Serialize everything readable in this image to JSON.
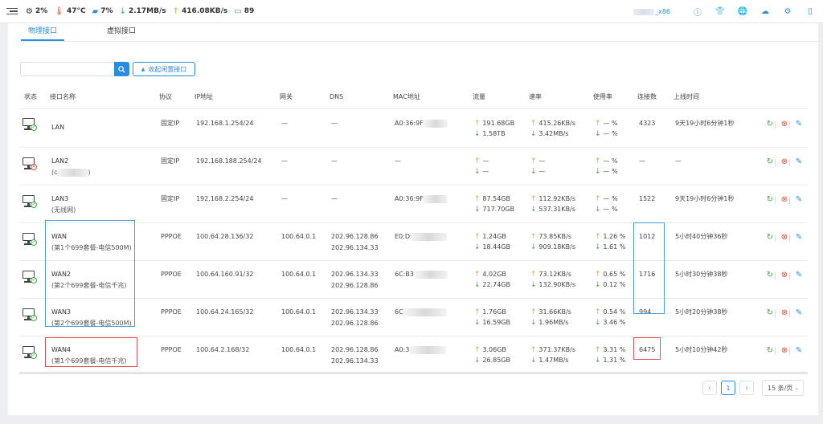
{
  "topbar": {
    "cpu": "2%",
    "temp": "47°C",
    "mem": "7%",
    "down": "2.17MB/s",
    "up": "416.08KB/s",
    "online": "89",
    "brand_suffix": "_x86"
  },
  "tabs": [
    "物理接口",
    "虚拟接口"
  ],
  "search": {
    "placeholder": ""
  },
  "collapse_label": "收起闲置接口",
  "columns": [
    "状态",
    "接口名称",
    "协议",
    "IP地址",
    "网关",
    "DNS",
    "MAC地址",
    "流量",
    "速率",
    "使用率",
    "连接数",
    "上线时间"
  ],
  "rows": [
    {
      "name": "LAN",
      "desc": "",
      "status": "ok",
      "protocol": "固定IP",
      "ip": "192.168.1.254/24",
      "gateway": "—",
      "dns1": "—",
      "dns2": "",
      "mac": "A0:36:9F",
      "mac_masked": true,
      "traffic_up": "191.68GB",
      "traffic_down": "1.58TB",
      "rate_up": "415.26KB/s",
      "rate_down": "3.42MB/s",
      "usage_up": "— %",
      "usage_down": "— %",
      "conns": "4323",
      "uptime": "9天19小时6分钟1秒"
    },
    {
      "name": "LAN2",
      "desc": "(c",
      "desc_tail": ")",
      "status": "bad",
      "protocol": "固定IP",
      "ip": "192.168.188.254/24",
      "gateway": "—",
      "dns1": "—",
      "dns2": "",
      "mac": "—",
      "mac_masked": false,
      "traffic_up": "—",
      "traffic_down": "—",
      "rate_up": "—",
      "rate_down": "—",
      "usage_up": "— %",
      "usage_down": "— %",
      "conns": "—",
      "uptime": "—"
    },
    {
      "name": "LAN3",
      "desc": "(无线网)",
      "status": "ok",
      "protocol": "固定IP",
      "ip": "192.168.2.254/24",
      "gateway": "—",
      "dns1": "—",
      "dns2": "",
      "mac": "A0:36:9F",
      "mac_masked": true,
      "traffic_up": "87.54GB",
      "traffic_down": "717.70GB",
      "rate_up": "112.92KB/s",
      "rate_down": "537.31KB/s",
      "usage_up": "— %",
      "usage_down": "— %",
      "conns": "1522",
      "uptime": "9天19小时6分钟1秒"
    },
    {
      "name": "WAN",
      "desc": "(第1个699套餐-电信500M)",
      "status": "ok",
      "protocol": "PPPOE",
      "ip": "100.64.28.136/32",
      "gateway": "100.64.0.1",
      "dns1": "202.96.128.86",
      "dns2": "202.96.134.33",
      "mac": "E0:D",
      "mac_masked": true,
      "traffic_up": "1.24GB",
      "traffic_down": "18.44GB",
      "rate_up": "73.85KB/s",
      "rate_down": "909.18KB/s",
      "usage_up": "1.26 %",
      "usage_down": "1.61 %",
      "conns": "1012",
      "uptime": "5小时40分钟36秒"
    },
    {
      "name": "WAN2",
      "desc": "(第2个699套餐-电信千兆)",
      "status": "ok",
      "protocol": "PPPOE",
      "ip": "100.64.160.91/32",
      "gateway": "100.64.0.1",
      "dns1": "202.96.134.33",
      "dns2": "202.96.128.86",
      "mac": "6C:B3",
      "mac_masked": true,
      "traffic_up": "4.02GB",
      "traffic_down": "22.74GB",
      "rate_up": "73.12KB/s",
      "rate_down": "132.90KB/s",
      "usage_up": "0.65 %",
      "usage_down": "0.12 %",
      "conns": "1716",
      "uptime": "5小时30分钟38秒"
    },
    {
      "name": "WAN3",
      "desc": "(第2个699套餐-电信500M)",
      "status": "ok",
      "protocol": "PPPOE",
      "ip": "100.64.24.165/32",
      "gateway": "100.64.0.1",
      "dns1": "202.96.134.33",
      "dns2": "202.96.128.86",
      "mac": "6C",
      "mac_masked": true,
      "traffic_up": "1.76GB",
      "traffic_down": "16.59GB",
      "rate_up": "31.66KB/s",
      "rate_down": "1.96MB/s",
      "usage_up": "0.54 %",
      "usage_down": "3.46 %",
      "conns": "994",
      "uptime": "5小时20分钟38秒"
    },
    {
      "name": "WAN4",
      "desc": "(第1个699套餐-电信千兆)",
      "status": "ok",
      "protocol": "PPPOE",
      "ip": "100.64.2.168/32",
      "gateway": "100.64.0.1",
      "dns1": "202.96.128.86",
      "dns2": "202.96.134.33",
      "mac": "A0:3",
      "mac_masked": true,
      "traffic_up": "3.06GB",
      "traffic_down": "26.85GB",
      "rate_up": "371.37KB/s",
      "rate_down": "1.47MB/s",
      "usage_up": "3.31 %",
      "usage_down": "1.31 %",
      "conns": "6475",
      "uptime": "5小时10分钟42秒"
    }
  ],
  "pagination": {
    "current": "1",
    "page_size": "15 条/页"
  },
  "colors": {
    "accent": "#2a8ee0",
    "up": "#f39c2c",
    "down": "#3fa745",
    "danger": "#e74c3c"
  }
}
